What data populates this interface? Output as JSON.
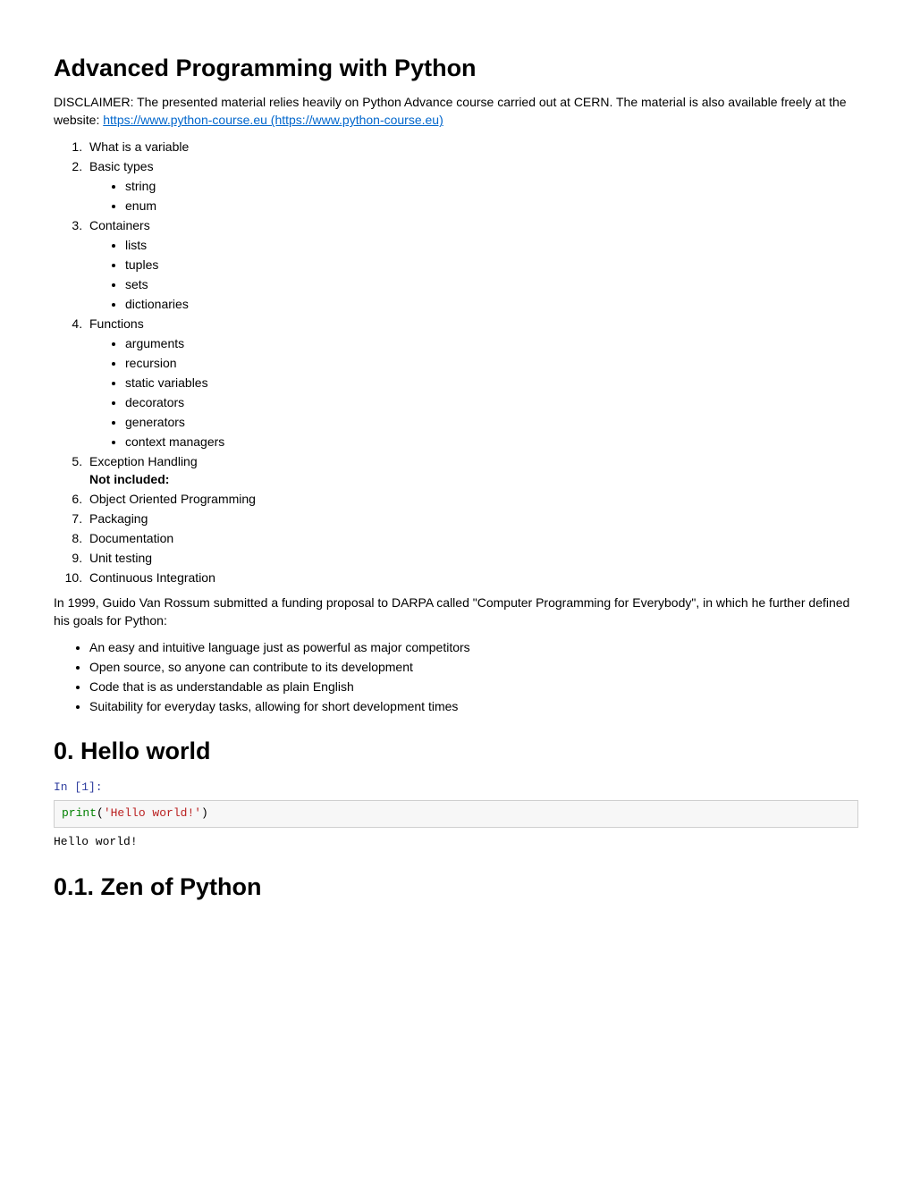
{
  "title": "Advanced Programming with Python",
  "disclaimer_prefix": "DISCLAIMER: The presented material relies heavily on Python Advance course carried out at CERN. The material is also available freely at the website: ",
  "link_text": "https://www.python-course.eu (https://www.python-course.eu)",
  "toc": {
    "items": [
      "What is a variable",
      "Basic types",
      "Containers",
      "Functions",
      "Exception Handling",
      "Object Oriented Programming",
      "Packaging",
      "Documentation",
      "Unit testing",
      "Continuous Integration"
    ],
    "sub_basic_types": [
      "string",
      "enum"
    ],
    "sub_containers": [
      "lists",
      "tuples",
      "sets",
      "dictionaries"
    ],
    "sub_functions": [
      "arguments",
      "recursion",
      "static variables",
      "decorators",
      "generators",
      "context managers"
    ],
    "not_included_label": "Not included"
  },
  "history_para": "In 1999, Guido Van Rossum submitted a funding proposal to DARPA called \"Computer Programming for Everybody\", in which he further defined his goals for Python:",
  "goals": [
    "An easy and intuitive language just as powerful as major competitors",
    "Open source, so anyone can contribute to its development",
    "Code that is as understandable as plain English",
    "Suitability for everyday tasks, allowing for short development times"
  ],
  "section_0": "0. Hello world",
  "cell1": {
    "prompt": "In [1]:",
    "fn": "print",
    "paren_open": "(",
    "str": "'Hello world!'",
    "paren_close": ")",
    "output": "Hello world!"
  },
  "section_01": "0.1. Zen of Python"
}
